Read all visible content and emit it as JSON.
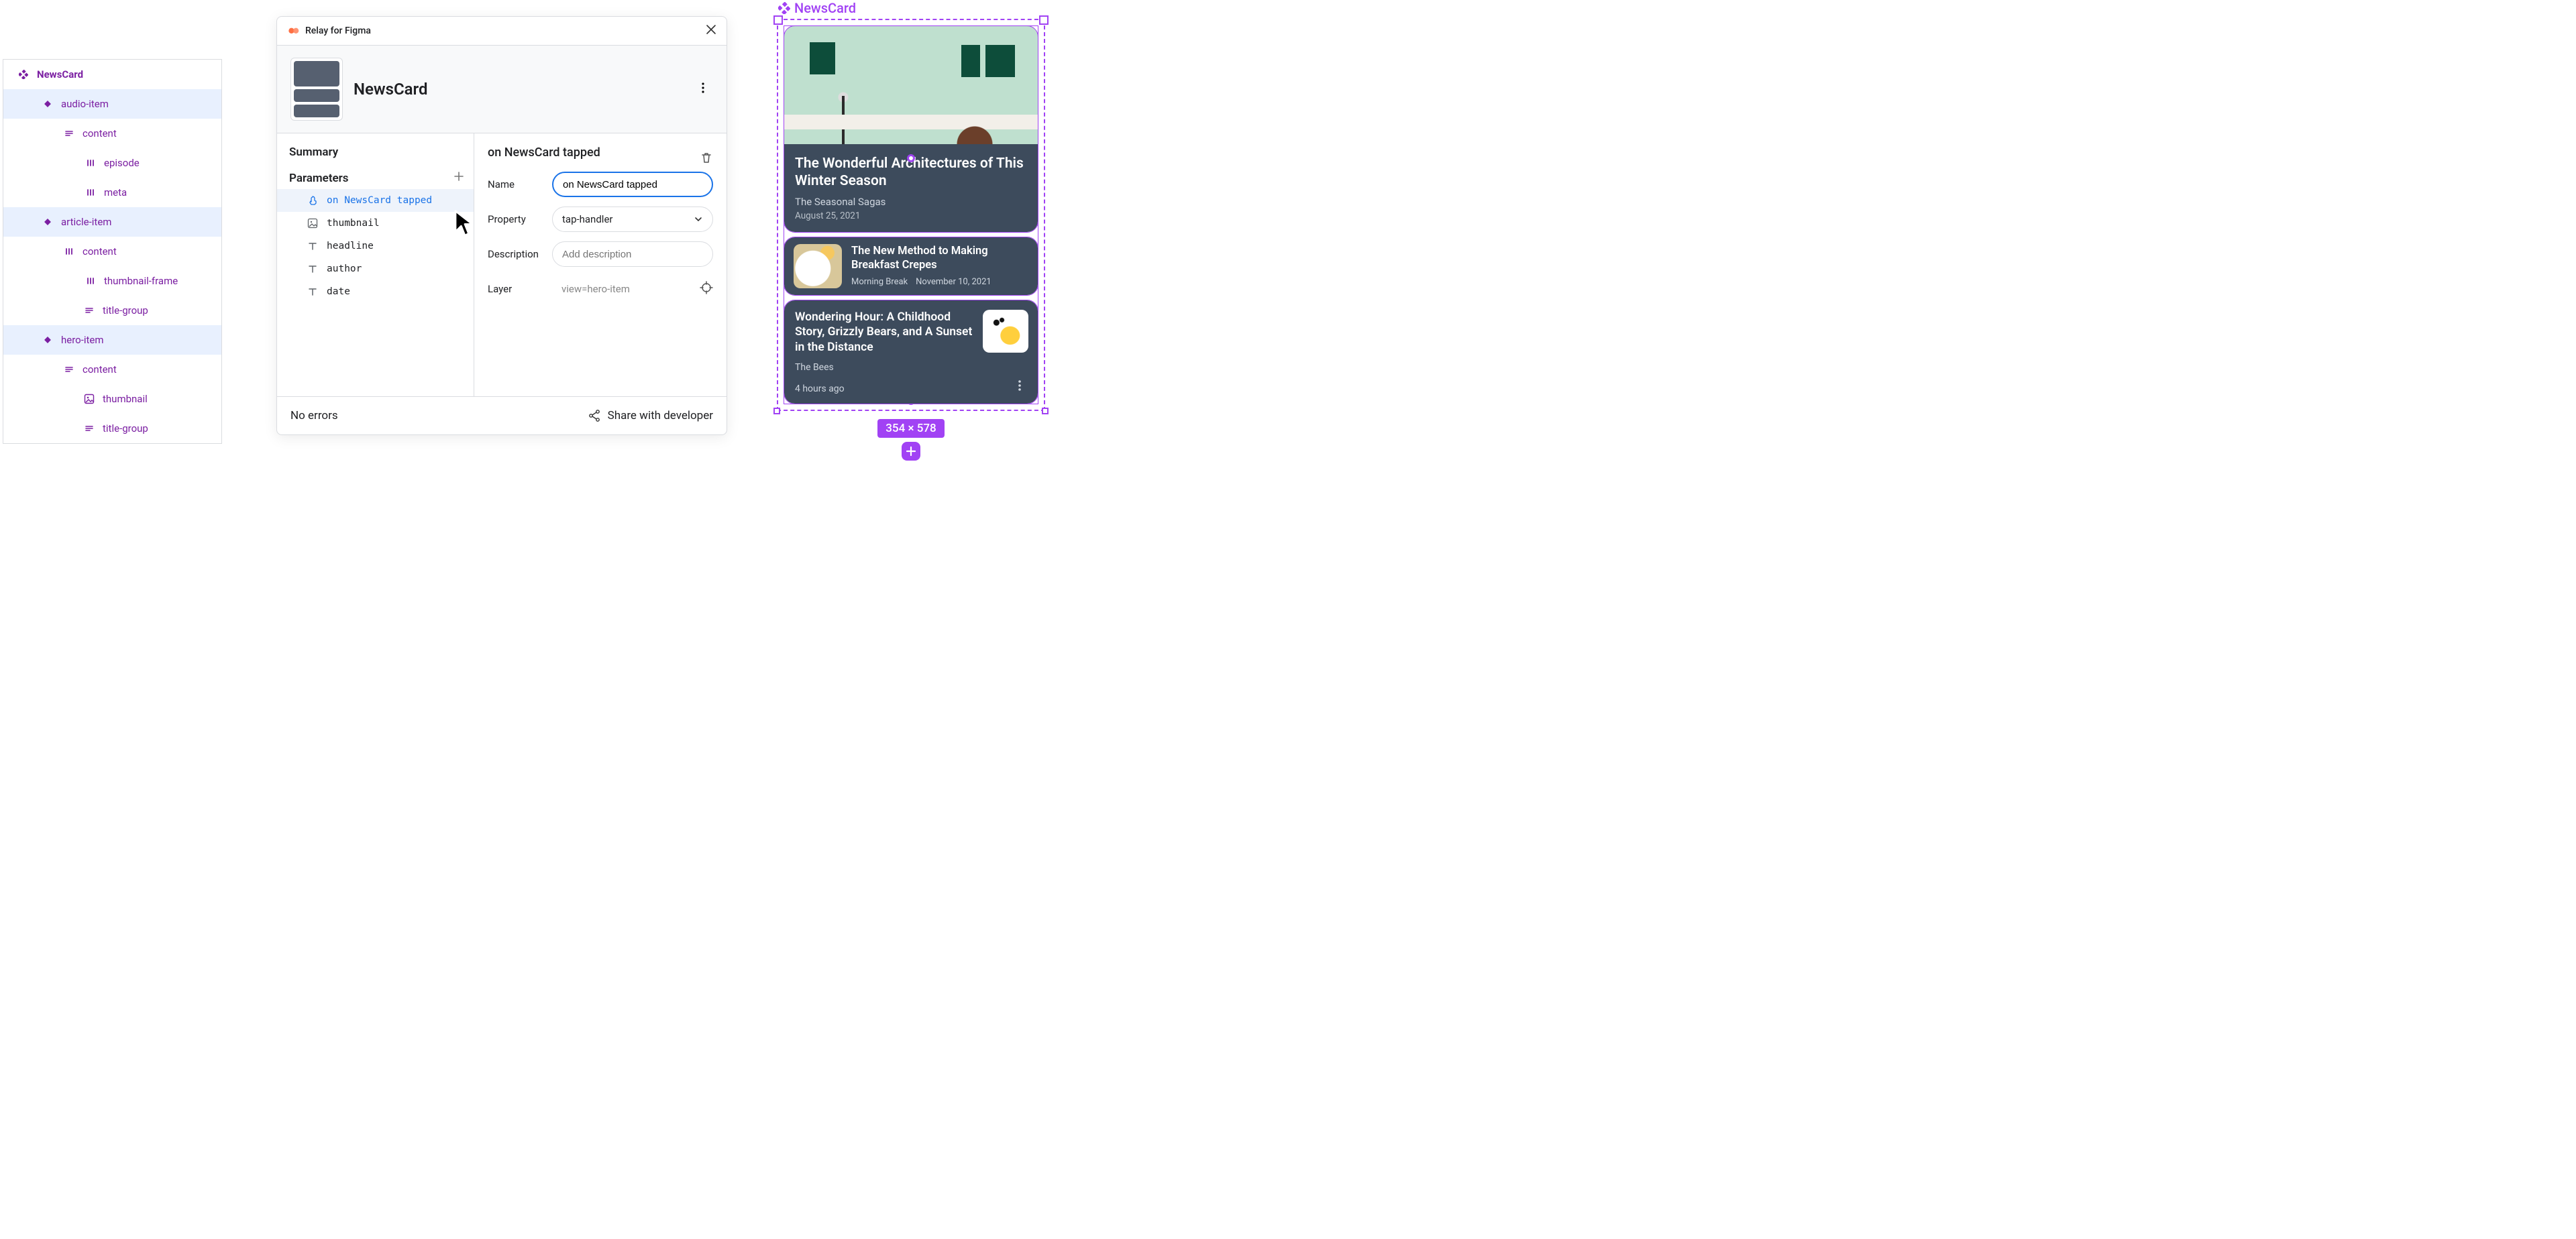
{
  "layers": {
    "component": "NewsCard",
    "items": [
      {
        "name": "audio-item",
        "depth": "d1",
        "icon": "diamond",
        "selected": true
      },
      {
        "name": "content",
        "depth": "d2",
        "icon": "lines",
        "selected": false
      },
      {
        "name": "episode",
        "depth": "d3",
        "icon": "bars",
        "selected": false
      },
      {
        "name": "meta",
        "depth": "d3",
        "icon": "bars",
        "selected": false
      },
      {
        "name": "article-item",
        "depth": "d1",
        "icon": "diamond",
        "selected": true
      },
      {
        "name": "content",
        "depth": "d2",
        "icon": "bars",
        "selected": false
      },
      {
        "name": "thumbnail-frame",
        "depth": "d3",
        "icon": "bars",
        "selected": false
      },
      {
        "name": "title-group",
        "depth": "d3b",
        "icon": "lines",
        "selected": false
      },
      {
        "name": "hero-item",
        "depth": "d1",
        "icon": "diamond",
        "selected": true
      },
      {
        "name": "content",
        "depth": "d2",
        "icon": "lines",
        "selected": false
      },
      {
        "name": "thumbnail",
        "depth": "d3b",
        "icon": "image",
        "selected": false
      },
      {
        "name": "title-group",
        "depth": "d3b",
        "icon": "lines",
        "selected": false
      }
    ]
  },
  "plugin": {
    "title": "Relay for Figma",
    "component": "NewsCard",
    "summary_label": "Summary",
    "parameters_label": "Parameters",
    "params": [
      {
        "name": "on NewsCard tapped",
        "icon": "tap",
        "selected": true
      },
      {
        "name": "thumbnail",
        "icon": "image",
        "selected": false
      },
      {
        "name": "headline",
        "icon": "text",
        "selected": false
      },
      {
        "name": "author",
        "icon": "text",
        "selected": false
      },
      {
        "name": "date",
        "icon": "text",
        "selected": false
      }
    ],
    "detail": {
      "heading": "on NewsCard tapped",
      "fields": {
        "name_label": "Name",
        "name_value": "on NewsCard tapped",
        "property_label": "Property",
        "property_value": "tap-handler",
        "description_label": "Description",
        "description_placeholder": "Add description",
        "layer_label": "Layer",
        "layer_value": "view=hero-item"
      }
    },
    "footer": {
      "status": "No errors",
      "share": "Share with developer"
    }
  },
  "canvas": {
    "frame_label": "NewsCard",
    "dims": "354 × 578",
    "hero": {
      "headline": "The Wonderful Architectures of This Winter Season",
      "publication": "The Seasonal Sagas",
      "date": "August 25, 2021"
    },
    "article": {
      "headline": "The New Method to Making Breakfast Crepes",
      "publication": "Morning Break",
      "date": "November 10, 2021"
    },
    "audio": {
      "headline": "Wondering Hour: A Childhood Story, Grizzly Bears, and A Sunset in the Distance",
      "publication": "The Bees",
      "time": "4 hours ago"
    }
  }
}
